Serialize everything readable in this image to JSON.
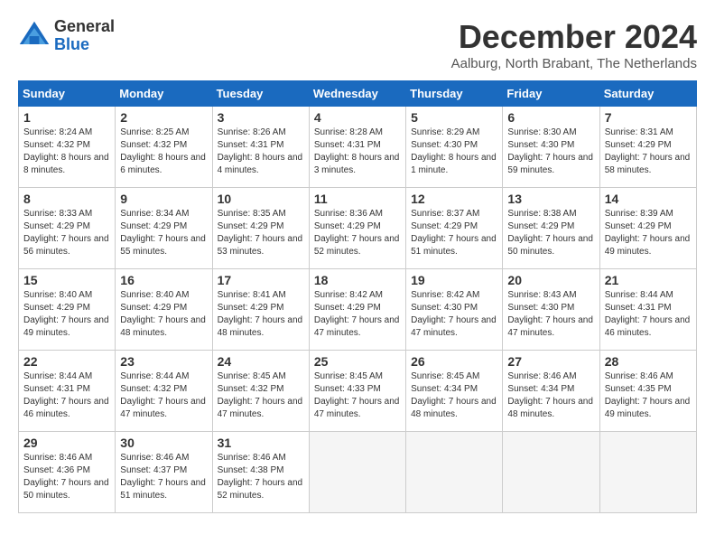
{
  "header": {
    "logo_general": "General",
    "logo_blue": "Blue",
    "month_title": "December 2024",
    "location": "Aalburg, North Brabant, The Netherlands"
  },
  "weekdays": [
    "Sunday",
    "Monday",
    "Tuesday",
    "Wednesday",
    "Thursday",
    "Friday",
    "Saturday"
  ],
  "weeks": [
    [
      {
        "day": "1",
        "sunrise": "Sunrise: 8:24 AM",
        "sunset": "Sunset: 4:32 PM",
        "daylight": "Daylight: 8 hours and 8 minutes."
      },
      {
        "day": "2",
        "sunrise": "Sunrise: 8:25 AM",
        "sunset": "Sunset: 4:32 PM",
        "daylight": "Daylight: 8 hours and 6 minutes."
      },
      {
        "day": "3",
        "sunrise": "Sunrise: 8:26 AM",
        "sunset": "Sunset: 4:31 PM",
        "daylight": "Daylight: 8 hours and 4 minutes."
      },
      {
        "day": "4",
        "sunrise": "Sunrise: 8:28 AM",
        "sunset": "Sunset: 4:31 PM",
        "daylight": "Daylight: 8 hours and 3 minutes."
      },
      {
        "day": "5",
        "sunrise": "Sunrise: 8:29 AM",
        "sunset": "Sunset: 4:30 PM",
        "daylight": "Daylight: 8 hours and 1 minute."
      },
      {
        "day": "6",
        "sunrise": "Sunrise: 8:30 AM",
        "sunset": "Sunset: 4:30 PM",
        "daylight": "Daylight: 7 hours and 59 minutes."
      },
      {
        "day": "7",
        "sunrise": "Sunrise: 8:31 AM",
        "sunset": "Sunset: 4:29 PM",
        "daylight": "Daylight: 7 hours and 58 minutes."
      }
    ],
    [
      {
        "day": "8",
        "sunrise": "Sunrise: 8:33 AM",
        "sunset": "Sunset: 4:29 PM",
        "daylight": "Daylight: 7 hours and 56 minutes."
      },
      {
        "day": "9",
        "sunrise": "Sunrise: 8:34 AM",
        "sunset": "Sunset: 4:29 PM",
        "daylight": "Daylight: 7 hours and 55 minutes."
      },
      {
        "day": "10",
        "sunrise": "Sunrise: 8:35 AM",
        "sunset": "Sunset: 4:29 PM",
        "daylight": "Daylight: 7 hours and 53 minutes."
      },
      {
        "day": "11",
        "sunrise": "Sunrise: 8:36 AM",
        "sunset": "Sunset: 4:29 PM",
        "daylight": "Daylight: 7 hours and 52 minutes."
      },
      {
        "day": "12",
        "sunrise": "Sunrise: 8:37 AM",
        "sunset": "Sunset: 4:29 PM",
        "daylight": "Daylight: 7 hours and 51 minutes."
      },
      {
        "day": "13",
        "sunrise": "Sunrise: 8:38 AM",
        "sunset": "Sunset: 4:29 PM",
        "daylight": "Daylight: 7 hours and 50 minutes."
      },
      {
        "day": "14",
        "sunrise": "Sunrise: 8:39 AM",
        "sunset": "Sunset: 4:29 PM",
        "daylight": "Daylight: 7 hours and 49 minutes."
      }
    ],
    [
      {
        "day": "15",
        "sunrise": "Sunrise: 8:40 AM",
        "sunset": "Sunset: 4:29 PM",
        "daylight": "Daylight: 7 hours and 49 minutes."
      },
      {
        "day": "16",
        "sunrise": "Sunrise: 8:40 AM",
        "sunset": "Sunset: 4:29 PM",
        "daylight": "Daylight: 7 hours and 48 minutes."
      },
      {
        "day": "17",
        "sunrise": "Sunrise: 8:41 AM",
        "sunset": "Sunset: 4:29 PM",
        "daylight": "Daylight: 7 hours and 48 minutes."
      },
      {
        "day": "18",
        "sunrise": "Sunrise: 8:42 AM",
        "sunset": "Sunset: 4:29 PM",
        "daylight": "Daylight: 7 hours and 47 minutes."
      },
      {
        "day": "19",
        "sunrise": "Sunrise: 8:42 AM",
        "sunset": "Sunset: 4:30 PM",
        "daylight": "Daylight: 7 hours and 47 minutes."
      },
      {
        "day": "20",
        "sunrise": "Sunrise: 8:43 AM",
        "sunset": "Sunset: 4:30 PM",
        "daylight": "Daylight: 7 hours and 47 minutes."
      },
      {
        "day": "21",
        "sunrise": "Sunrise: 8:44 AM",
        "sunset": "Sunset: 4:31 PM",
        "daylight": "Daylight: 7 hours and 46 minutes."
      }
    ],
    [
      {
        "day": "22",
        "sunrise": "Sunrise: 8:44 AM",
        "sunset": "Sunset: 4:31 PM",
        "daylight": "Daylight: 7 hours and 46 minutes."
      },
      {
        "day": "23",
        "sunrise": "Sunrise: 8:44 AM",
        "sunset": "Sunset: 4:32 PM",
        "daylight": "Daylight: 7 hours and 47 minutes."
      },
      {
        "day": "24",
        "sunrise": "Sunrise: 8:45 AM",
        "sunset": "Sunset: 4:32 PM",
        "daylight": "Daylight: 7 hours and 47 minutes."
      },
      {
        "day": "25",
        "sunrise": "Sunrise: 8:45 AM",
        "sunset": "Sunset: 4:33 PM",
        "daylight": "Daylight: 7 hours and 47 minutes."
      },
      {
        "day": "26",
        "sunrise": "Sunrise: 8:45 AM",
        "sunset": "Sunset: 4:34 PM",
        "daylight": "Daylight: 7 hours and 48 minutes."
      },
      {
        "day": "27",
        "sunrise": "Sunrise: 8:46 AM",
        "sunset": "Sunset: 4:34 PM",
        "daylight": "Daylight: 7 hours and 48 minutes."
      },
      {
        "day": "28",
        "sunrise": "Sunrise: 8:46 AM",
        "sunset": "Sunset: 4:35 PM",
        "daylight": "Daylight: 7 hours and 49 minutes."
      }
    ],
    [
      {
        "day": "29",
        "sunrise": "Sunrise: 8:46 AM",
        "sunset": "Sunset: 4:36 PM",
        "daylight": "Daylight: 7 hours and 50 minutes."
      },
      {
        "day": "30",
        "sunrise": "Sunrise: 8:46 AM",
        "sunset": "Sunset: 4:37 PM",
        "daylight": "Daylight: 7 hours and 51 minutes."
      },
      {
        "day": "31",
        "sunrise": "Sunrise: 8:46 AM",
        "sunset": "Sunset: 4:38 PM",
        "daylight": "Daylight: 7 hours and 52 minutes."
      },
      null,
      null,
      null,
      null
    ]
  ]
}
